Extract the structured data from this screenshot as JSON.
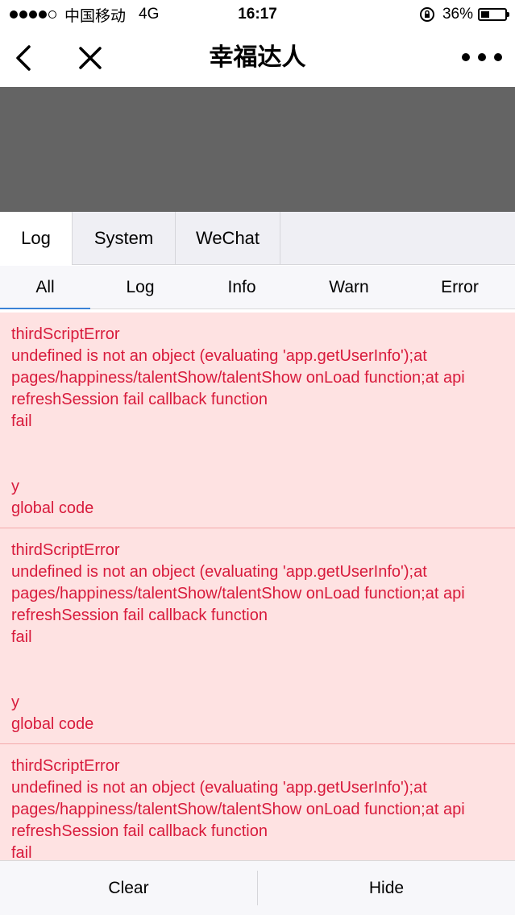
{
  "status_bar": {
    "carrier": "中国移动",
    "network": "4G",
    "time": "16:17",
    "battery": "36%",
    "battery_level": 0.36
  },
  "nav": {
    "title": "幸福达人",
    "back_icon": "chevron-left-icon",
    "close_icon": "close-icon",
    "more_icon": "more-dots-icon"
  },
  "main_tabs": [
    {
      "label": "Log",
      "active": true
    },
    {
      "label": "System",
      "active": false
    },
    {
      "label": "WeChat",
      "active": false
    }
  ],
  "sub_tabs": [
    {
      "label": "All",
      "active": true
    },
    {
      "label": "Log",
      "active": false
    },
    {
      "label": "Info",
      "active": false
    },
    {
      "label": "Warn",
      "active": false
    },
    {
      "label": "Error",
      "active": false
    }
  ],
  "logs": [
    {
      "text": "thirdScriptError\nundefined is not an object (evaluating 'app.getUserInfo');at pages/happiness/talentShow/talentShow onLoad function;at api refreshSession fail callback function\nfail\n\n\ny\nglobal code"
    },
    {
      "text": "thirdScriptError\nundefined is not an object (evaluating 'app.getUserInfo');at pages/happiness/talentShow/talentShow onLoad function;at api refreshSession fail callback function\nfail\n\n\ny\nglobal code"
    },
    {
      "text": "thirdScriptError\nundefined is not an object (evaluating 'app.getUserInfo');at pages/happiness/talentShow/talentShow onLoad function;at api refreshSession fail callback function\nfail"
    }
  ],
  "bottom": {
    "clear_label": "Clear",
    "hide_label": "Hide"
  },
  "colors": {
    "error_text": "#d81b3c",
    "error_bg": "#fee2e2",
    "active_tab_underline": "#3b82d6",
    "header_gray": "#646464"
  }
}
